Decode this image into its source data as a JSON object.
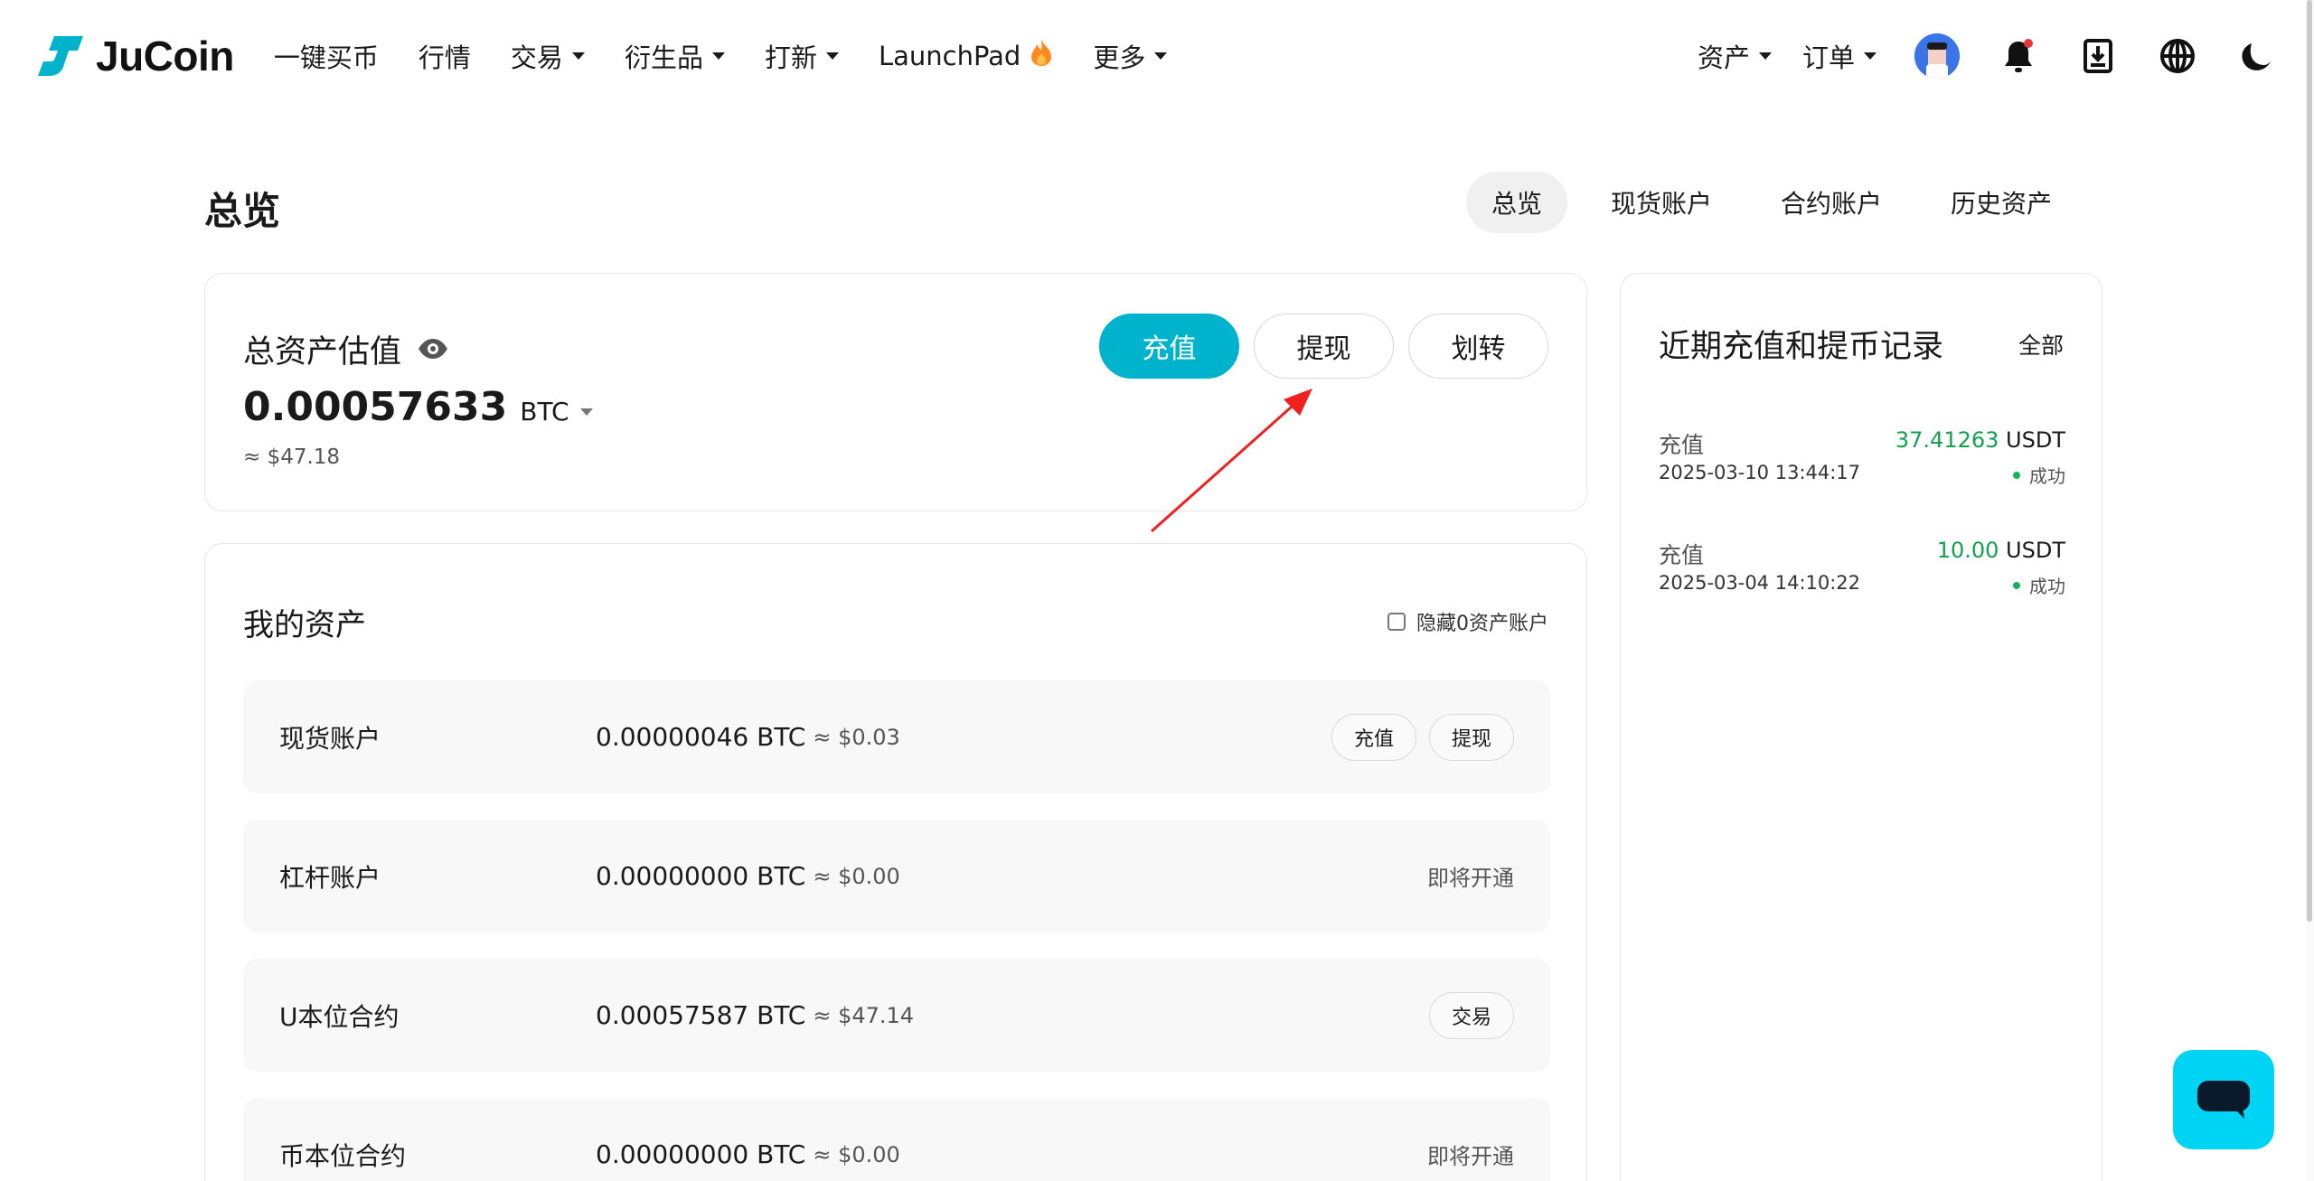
{
  "colors": {
    "brand": "#00b3cc",
    "success": "#14a14f",
    "chat": "#00d4f5"
  },
  "header": {
    "logo_text": "JuCoin",
    "nav": [
      {
        "label": "一键买币",
        "caret": false
      },
      {
        "label": "行情",
        "caret": false
      },
      {
        "label": "交易",
        "caret": true
      },
      {
        "label": "衍生品",
        "caret": true
      },
      {
        "label": "打新",
        "caret": true
      },
      {
        "label": "LaunchPad",
        "caret": false,
        "icon": "fire-icon"
      },
      {
        "label": "更多",
        "caret": true
      }
    ],
    "right": {
      "assets_label": "资产",
      "orders_label": "订单",
      "icons": [
        "avatar",
        "bell-icon",
        "download-icon",
        "globe-icon",
        "moon-icon"
      ]
    }
  },
  "page": {
    "title": "总览",
    "tabs": [
      {
        "label": "总览",
        "active": true
      },
      {
        "label": "现货账户",
        "active": false
      },
      {
        "label": "合约账户",
        "active": false
      },
      {
        "label": "历史资产",
        "active": false
      }
    ]
  },
  "total": {
    "label": "总资产估值",
    "value": "0.00057633",
    "unit": "BTC",
    "usd": "≈ $47.18",
    "buttons": {
      "deposit": "充值",
      "withdraw": "提现",
      "transfer": "划转"
    }
  },
  "assets": {
    "title": "我的资产",
    "hide_zero_label": "隐藏0资产账户",
    "rows": [
      {
        "name": "现货账户",
        "amount": "0.00000046 BTC",
        "usd": "≈ $0.03",
        "actions": [
          "充值",
          "提现"
        ],
        "coming": ""
      },
      {
        "name": "杠杆账户",
        "amount": "0.00000000 BTC",
        "usd": "≈ $0.00",
        "actions": [],
        "coming": "即将开通"
      },
      {
        "name": "U本位合约",
        "amount": "0.00057587 BTC",
        "usd": "≈ $47.14",
        "actions": [
          "交易"
        ],
        "coming": ""
      },
      {
        "name": "币本位合约",
        "amount": "0.00000000 BTC",
        "usd": "≈ $0.00",
        "actions": [],
        "coming": "即将开通"
      }
    ]
  },
  "records": {
    "title": "近期充值和提币记录",
    "all_label": "全部",
    "items": [
      {
        "type": "充值",
        "time": "2025-03-10 13:44:17",
        "amount": "37.41263",
        "currency": "USDT",
        "status": "成功"
      },
      {
        "type": "充值",
        "time": "2025-03-04 14:10:22",
        "amount": "10.00",
        "currency": "USDT",
        "status": "成功"
      }
    ]
  }
}
